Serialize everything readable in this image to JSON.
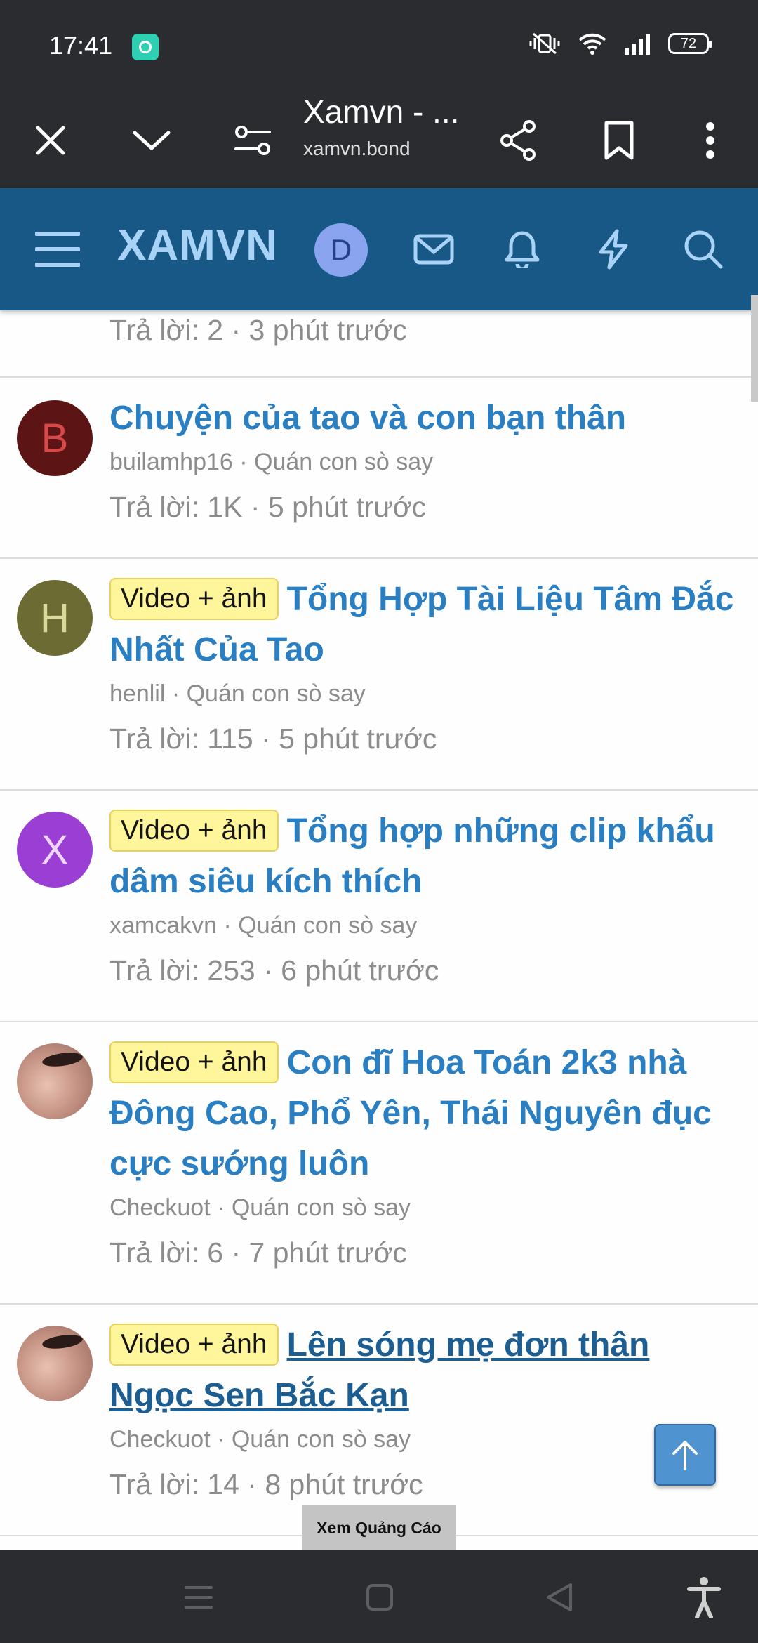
{
  "status_bar": {
    "time": "17:41",
    "battery_level": "72",
    "icons": [
      "notification-app-icon",
      "vibrate-icon",
      "wifi-icon",
      "signal-icon",
      "battery-icon"
    ]
  },
  "browser": {
    "title": "Xamvn - ...",
    "url": "xamvn.bond",
    "icons": [
      "close-icon",
      "chevron-down-icon",
      "site-settings-icon",
      "share-icon",
      "bookmark-icon",
      "more-vert-icon"
    ]
  },
  "forum": {
    "logo": "XAMVN",
    "user_initial": "D",
    "icons": [
      "menu-icon",
      "mail-icon",
      "bell-icon",
      "lightning-icon",
      "search-icon"
    ]
  },
  "threads": [
    {
      "stats_label": "Trả lời:",
      "replies": "2",
      "time": "3 phút trước"
    },
    {
      "avatar_letter": "B",
      "avatar_color": "#5c1414",
      "avatar_text_color": "#d94848",
      "title": "Chuyện của tao và con bạn thân",
      "author": "builamhp16",
      "forum": "Quán con sò say",
      "stats_label": "Trả lời:",
      "replies": "1K",
      "time": "5 phút trước"
    },
    {
      "avatar_letter": "H",
      "avatar_color": "#6b6b33",
      "avatar_text_color": "#d9d99a",
      "prefix": "Video + ảnh",
      "title": "Tổng Hợp Tài Liệu Tâm Đắc Nhất Của Tao",
      "author": "henlil",
      "forum": "Quán con sò say",
      "stats_label": "Trả lời:",
      "replies": "115",
      "time": "5 phút trước"
    },
    {
      "avatar_letter": "X",
      "avatar_color": "#9b3fd4",
      "avatar_text_color": "#efd6ff",
      "prefix": "Video + ảnh",
      "title": "Tổng hợp những clip khẩu dâm siêu kích thích",
      "author": "xamcakvn",
      "forum": "Quán con sò say",
      "stats_label": "Trả lời:",
      "replies": "253",
      "time": "6 phút trước"
    },
    {
      "prefix": "Video + ảnh",
      "title": "Con đĩ Hoa Toán 2k3 nhà Đông Cao, Phổ Yên, Thái Nguyên đục cực sướng luôn",
      "author": "Checkuot",
      "forum": "Quán con sò say",
      "stats_label": "Trả lời:",
      "replies": "6",
      "time": "7 phút trước"
    },
    {
      "prefix": "Video + ảnh",
      "title": "Lên sóng mẹ đơn thân Ngọc Sen Bắc Kạn",
      "author": "Checkuot",
      "forum": "Quán con sò say",
      "stats_label": "Trả lời:",
      "replies": "14",
      "time": "8 phút trước"
    }
  ],
  "overlay": {
    "ad_label": "Xem Quảng Cáo",
    "scroll_top_icon": "arrow-up-icon"
  },
  "nav_bar": {
    "icons": [
      "recent-apps-icon",
      "home-icon",
      "back-icon",
      "accessibility-icon"
    ]
  },
  "colors": {
    "browser_chrome": "#2b2c30",
    "forum_header": "#185886",
    "logo": "#a9d2f7",
    "link": "#2a7fc2",
    "visited_link": "#1d5e92",
    "prefix_bg": "#fff69b",
    "meta": "#8c8c8c"
  }
}
